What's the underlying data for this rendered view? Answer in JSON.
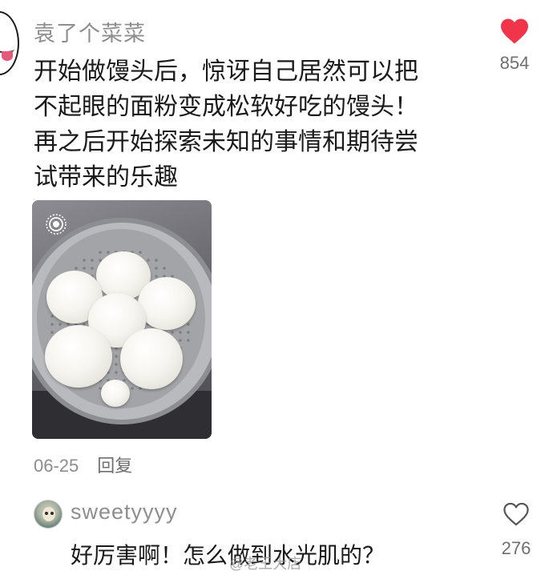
{
  "comment": {
    "username": "袁了个菜菜",
    "lines": [
      "开始做馒头后，惊讶自己居然可以把",
      "不起眼的面粉变成松软好吃的馒头！",
      "再之后开始探索未知的事情和期待尝",
      "试带来的乐趣"
    ],
    "likes": "854",
    "like_icon": "heart-filled-icon",
    "like_color": "#f0344a",
    "date": "06-25",
    "reply_label": "回复"
  },
  "photo": {
    "content": "steamed-buns-photo",
    "overlay_icon": "live-photo-icon"
  },
  "reply": {
    "username": "sweetyyyy",
    "text": "好厉害啊！怎么做到水光肌的？",
    "likes": "276",
    "like_icon": "heart-outline-icon"
  },
  "watermark": "@老王大店"
}
